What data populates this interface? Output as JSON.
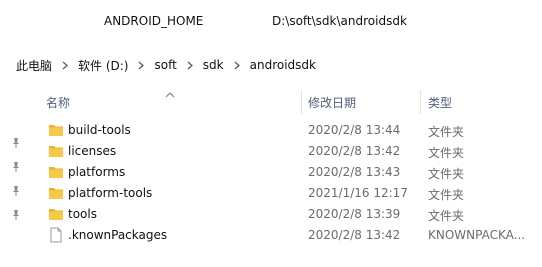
{
  "env": {
    "name": "ANDROID_HOME",
    "value": "D:\\soft\\sdk\\androidsdk"
  },
  "breadcrumb": [
    "此电脑",
    "软件 (D:)",
    "soft",
    "sdk",
    "androidsdk"
  ],
  "columns": {
    "name": "名称",
    "date": "修改日期",
    "type": "类型"
  },
  "files": [
    {
      "name": "build-tools",
      "date": "2020/2/8 13:44",
      "type": "文件夹",
      "icon": "folder-icon"
    },
    {
      "name": "licenses",
      "date": "2020/2/8 13:42",
      "type": "文件夹",
      "icon": "folder-icon"
    },
    {
      "name": "platforms",
      "date": "2020/2/8 13:43",
      "type": "文件夹",
      "icon": "folder-icon"
    },
    {
      "name": "platform-tools",
      "date": "2021/1/16 12:17",
      "type": "文件夹",
      "icon": "folder-icon"
    },
    {
      "name": "tools",
      "date": "2020/2/8 13:39",
      "type": "文件夹",
      "icon": "folder-icon"
    },
    {
      "name": ".knownPackages",
      "date": "2020/2/8 13:42",
      "type": "KNOWNPACKA...",
      "icon": "file-icon"
    }
  ],
  "colors": {
    "folder": "#f7c948",
    "folder_dark": "#e8b22a",
    "header_text": "#4c607a",
    "meta_text": "#6b6b6b"
  }
}
